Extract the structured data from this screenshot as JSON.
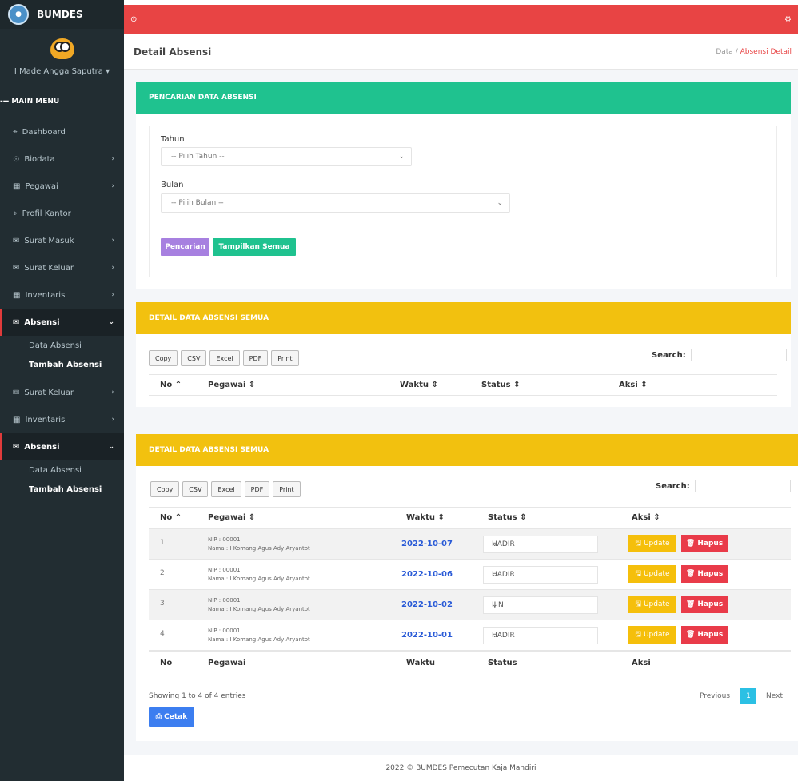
{
  "brand": {
    "name": "BUMDES"
  },
  "user": {
    "name": "I Made Angga Saputra",
    "caret": "▾"
  },
  "sidebar": {
    "section": "--- MAIN MENU",
    "items": [
      {
        "icon": "⌖",
        "label": "Dashboard",
        "chev": ""
      },
      {
        "icon": "⊙",
        "label": "Biodata",
        "chev": "›"
      },
      {
        "icon": "▦",
        "label": "Pegawai",
        "chev": "›"
      },
      {
        "icon": "⌖",
        "label": "Profil Kantor",
        "chev": ""
      },
      {
        "icon": "✉",
        "label": "Surat Masuk",
        "chev": "›"
      },
      {
        "icon": "✉",
        "label": "Surat Keluar",
        "chev": "›"
      },
      {
        "icon": "▦",
        "label": "Inventaris",
        "chev": "›"
      },
      {
        "icon": "✉",
        "label": "Absensi",
        "chev": "⌄"
      }
    ],
    "sub": [
      "Data Absensi",
      "Tambah Absensi"
    ],
    "items2": [
      {
        "icon": "✉",
        "label": "Surat Keluar",
        "chev": "›"
      },
      {
        "icon": "▦",
        "label": "Inventaris",
        "chev": "›"
      },
      {
        "icon": "✉",
        "label": "Absensi",
        "chev": "⌄"
      }
    ]
  },
  "topbar": {
    "left_icon": "⊙",
    "right_icon": "⚙"
  },
  "header": {
    "title": "Detail Absensi",
    "crumb_1": "Data",
    "crumb_sep": "/",
    "crumb_2": "Absensi Detail"
  },
  "search_panel": {
    "title": "PENCARIAN DATA ABSENSI",
    "tahun_label": "Tahun",
    "tahun_value": "-- Pilih Tahun --",
    "bulan_label": "Bulan",
    "bulan_value": "-- Pilih Bulan --",
    "btn_search": "Pencarian",
    "btn_all": "Tampilkan Semua"
  },
  "table_panel_1": {
    "title": "DETAIL DATA ABSENSI SEMUA",
    "export": [
      "Copy",
      "CSV",
      "Excel",
      "PDF",
      "Print"
    ],
    "search_label": "Search:",
    "columns": [
      "No ⌃",
      "Pegawai ⇕",
      "Waktu ⇕",
      "Status ⇕",
      "Aksi ⇕"
    ]
  },
  "table_panel_2": {
    "title": "DETAIL DATA ABSENSI SEMUA",
    "export": [
      "Copy",
      "CSV",
      "Excel",
      "PDF",
      "Print"
    ],
    "search_label": "Search:",
    "columns": [
      "No ⌃",
      "Pegawai ⇕",
      "Waktu ⇕",
      "Status ⇕",
      "Aksi ⇕"
    ],
    "rows": [
      {
        "no": "1",
        "nip": "NIP : 00001",
        "nama": "Nama : I Komang Agus Ady Aryantot",
        "waktu": "2022-10-07",
        "status": "HADIR"
      },
      {
        "no": "2",
        "nip": "NIP : 00001",
        "nama": "Nama : I Komang Agus Ady Aryantot",
        "waktu": "2022-10-06",
        "status": "HADIR"
      },
      {
        "no": "3",
        "nip": "NIP : 00001",
        "nama": "Nama : I Komang Agus Ady Aryantot",
        "waktu": "2022-10-02",
        "status": "IJIN"
      },
      {
        "no": "4",
        "nip": "NIP : 00001",
        "nama": "Nama : I Komang Agus Ady Aryantot",
        "waktu": "2022-10-01",
        "status": "HADIR"
      }
    ],
    "update_label": "🖫 Update",
    "hapus_label": "🗑 Hapus",
    "footer_cols": [
      "No",
      "Pegawai",
      "Waktu",
      "Status",
      "Aksi"
    ],
    "info": "Showing 1 to 4 of 4 entries",
    "prev": "Previous",
    "page": "1",
    "next": "Next",
    "print_btn": "⎙ Cetak"
  },
  "footer": {
    "text": "2022 © BUMDES Pemecutan Kaja Mandiri"
  },
  "colors": {
    "topbar": "#e84444",
    "green": "#1fc28f",
    "yellow": "#f2c10f",
    "sidebar": "#222d32"
  }
}
